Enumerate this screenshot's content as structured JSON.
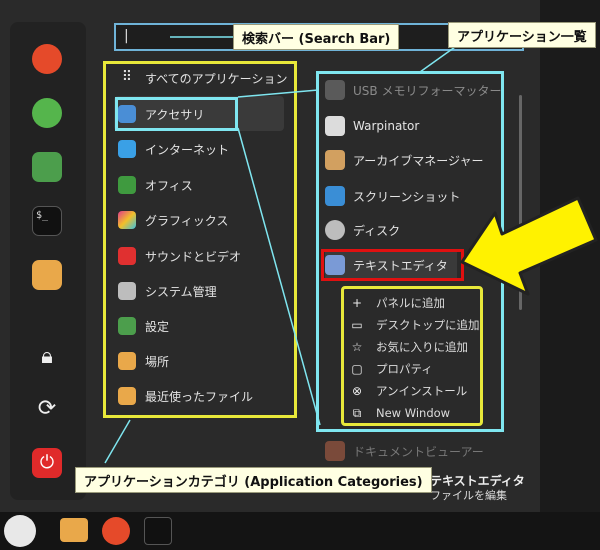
{
  "search": {
    "cursor": "|"
  },
  "favorites": [
    {
      "name": "firefox-icon"
    },
    {
      "name": "apps-grid-icon"
    },
    {
      "name": "toggle-icon"
    },
    {
      "name": "terminal-icon"
    },
    {
      "name": "folder-icon"
    }
  ],
  "session": [
    {
      "name": "lock-icon"
    },
    {
      "name": "logout-icon"
    },
    {
      "name": "power-icon"
    }
  ],
  "categories": [
    {
      "label": "すべてのアプリケーション",
      "icon": "grid-icon"
    },
    {
      "label": "アクセサリ",
      "icon": "scissors-icon"
    },
    {
      "label": "インターネット",
      "icon": "cloud-icon"
    },
    {
      "label": "オフィス",
      "icon": "office-icon"
    },
    {
      "label": "グラフィックス",
      "icon": "graphics-icon"
    },
    {
      "label": "サウンドとビデオ",
      "icon": "play-icon"
    },
    {
      "label": "システム管理",
      "icon": "system-icon"
    },
    {
      "label": "設定",
      "icon": "settings-icon"
    },
    {
      "label": "場所",
      "icon": "places-folder-icon"
    },
    {
      "label": "最近使ったファイル",
      "icon": "recent-icon"
    }
  ],
  "apps": [
    {
      "label": "USB メモリフォーマッター",
      "icon": "usb-icon"
    },
    {
      "label": "Warpinator",
      "icon": "warpinator-icon"
    },
    {
      "label": "アーカイブマネージャー",
      "icon": "archive-icon"
    },
    {
      "label": "スクリーンショット",
      "icon": "camera-icon"
    },
    {
      "label": "ディスク",
      "icon": "disk-icon"
    },
    {
      "label": "テキストエディタ",
      "icon": "text-editor-icon"
    }
  ],
  "context_menu": [
    {
      "glyph": "+",
      "label": "パネルに追加"
    },
    {
      "glyph": "▭",
      "label": "デスクトップに追加"
    },
    {
      "glyph": "☆",
      "label": "お気に入りに追加"
    },
    {
      "glyph": "▢",
      "label": "プロパティ"
    },
    {
      "glyph": "⊗",
      "label": "アンインストール"
    },
    {
      "glyph": "⧉",
      "label": "New Window"
    }
  ],
  "trailing_app": {
    "label": "ドキュメントビューアー"
  },
  "status": {
    "title": "テキストエディタ",
    "desc": "ファイルを編集"
  },
  "callouts": {
    "search": "検索バー (Search Bar)",
    "app_list": "アプリケーション一覧",
    "categories": "アプリケーションカテゴリ (Application Categories)"
  },
  "colors": {
    "yellow": "#e8e83a",
    "cyan": "#7fe6f0",
    "red": "#e01010",
    "arrow": "#fff200"
  }
}
